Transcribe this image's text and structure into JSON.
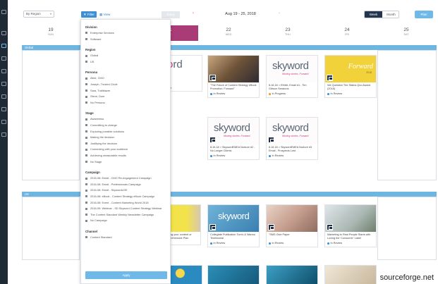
{
  "toolbar": {
    "region_select": "By Region",
    "filter_label": "Filter",
    "view_label": "View",
    "today_label": "Today",
    "date_range": "Aug 19 - 25, 2018",
    "week_label": "Week",
    "month_label": "Month",
    "plan_label": "Plan"
  },
  "days": [
    {
      "num": "19",
      "dow": "SUN"
    },
    {
      "num": "20",
      "dow": "MON"
    },
    {
      "num": "21",
      "dow": "TUE"
    },
    {
      "num": "22",
      "dow": "WED"
    },
    {
      "num": "23",
      "dow": "THU"
    },
    {
      "num": "24",
      "dow": "FRI"
    },
    {
      "num": "25",
      "dow": "SAT"
    }
  ],
  "groups": {
    "global": "Global",
    "us": "US"
  },
  "cards_global": [
    {
      "title": "",
      "status": "",
      "status_color": "#3a8ad6"
    },
    {
      "title": "\"The Future of Content Strategy eBook Promotion: Forward\"",
      "status": "In Review",
      "status_color": "#3a8ad6"
    },
    {
      "title": "8.16.18 > EMAIL Email #1 - Tim Gibson Sessions",
      "status": "In Progress",
      "status_color": "#f0932b"
    },
    {
      "title": "We Question The Status Quo Award (2018)",
      "status": "In Review",
      "status_color": "#3a8ad6"
    },
    {
      "title": "8.16.18 > SkywordEMEA Nurture #2 - No Longer Clients",
      "status": "In Review",
      "status_color": "#3a8ad6"
    },
    {
      "title": "8.16.18 > SkywordEMEA Nurture #3 Email - Prospects Lost",
      "status": "In Review",
      "status_color": "#3a8ad6"
    }
  ],
  "cards_us": [
    {
      "title": "Collegiate Publication Tom's & Wanno Testimonial",
      "status": "In Review",
      "status_color": "#3a8ad6"
    },
    {
      "title": "\"SMS Give Paper",
      "status": "In Review",
      "status_color": "#3a8ad6"
    },
    {
      "title": "Marketing to Real People Starts with Loving the 'Consumer' Label",
      "status": "In Review",
      "status_color": "#3a8ad6"
    }
  ],
  "partial_text": "...ing your content or ...prehensive Plan",
  "sky_logo": "skyword",
  "sky_tag": "Moving stories. Forward.",
  "forward_text": "Forward",
  "forward_year": "2018",
  "filter": {
    "sections": [
      {
        "name": "Division",
        "options": [
          "Enterprise Services",
          "Software"
        ]
      },
      {
        "name": "Region",
        "options": [
          "Global",
          "US"
        ]
      },
      {
        "name": "Persona",
        "options": [
          "Alice, CMO",
          "Joseph, Trusted Circle",
          "Sara, Trailblazer",
          "Steve, Doer",
          "No Persona"
        ]
      },
      {
        "name": "Stage",
        "options": [
          "Awareness",
          "Committing to change",
          "Exploring possible solutions",
          "Making the decision",
          "Justifying the decision",
          "Connecting with your audience",
          "Achieving measurable results",
          "No Stage"
        ]
      },
      {
        "name": "Campaign",
        "options": [
          "2016-08: Email - CMO Re-engagement Campaign",
          "2016-08: Email - Prefessionals Campaign",
          "2016-08: Email - SkywordUSE",
          "2016-08: eBook - Content Strategy eBook Campaign",
          "2016-08: Event - Content Marketing World 2018",
          "2016-09: Webinar - SD Skyword Content Strategy Webinar",
          "The Content Standard Weekly Newsletter Campaign",
          "No Campaign"
        ]
      },
      {
        "name": "Channel",
        "options": [
          "Content Standard"
        ]
      }
    ],
    "apply_label": "Apply"
  },
  "watermark": "sourceforge.net"
}
